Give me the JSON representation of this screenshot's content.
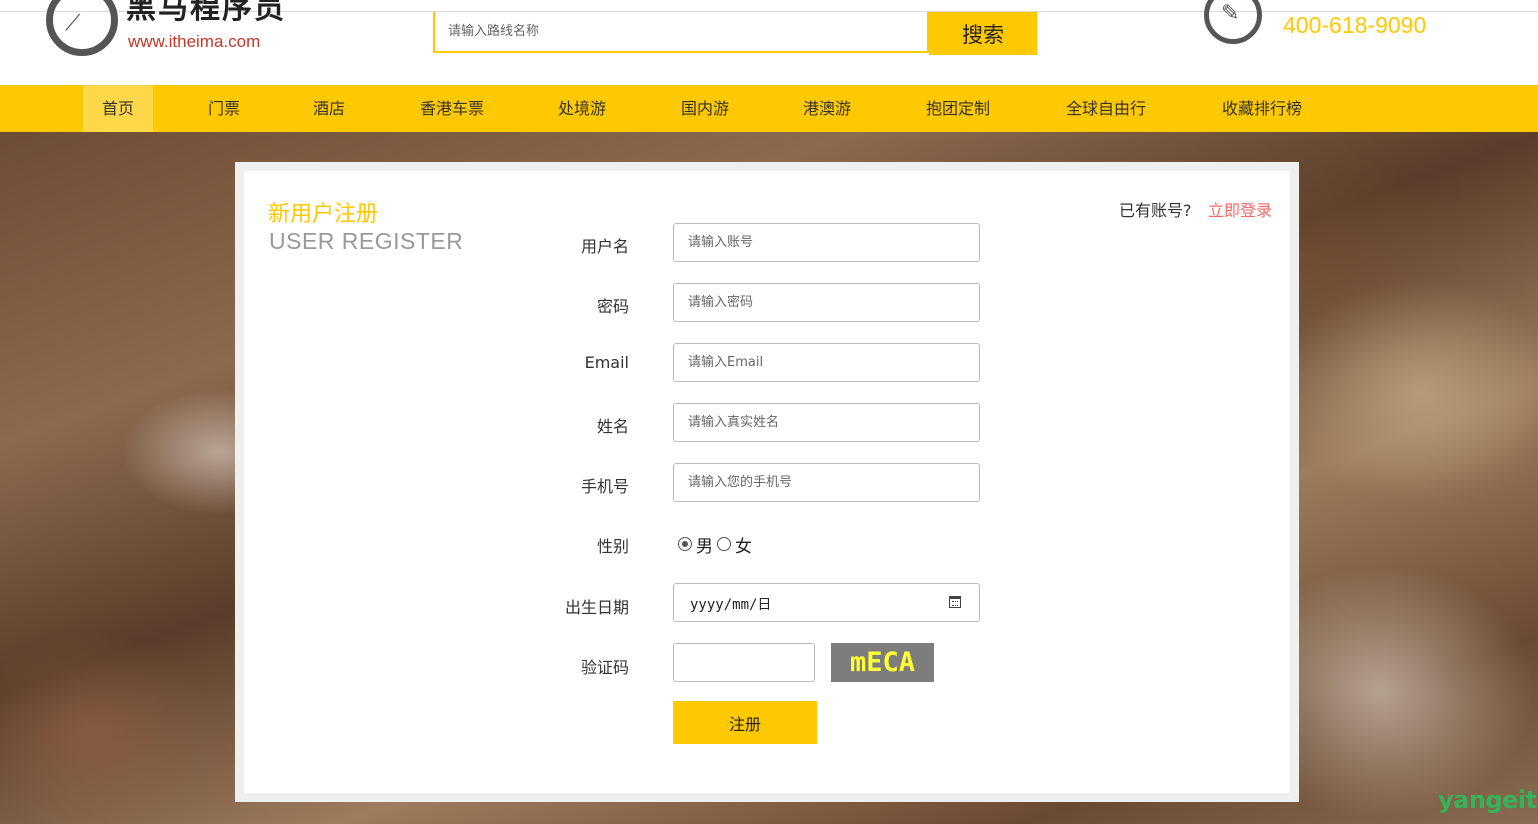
{
  "header": {
    "logo_cn": "黑马程序员",
    "logo_url": "www.itheima.com",
    "search_placeholder": "请输入路线名称",
    "search_button": "搜索",
    "phone": "400-618-9090"
  },
  "nav": {
    "items": [
      "首页",
      "门票",
      "酒店",
      "香港车票",
      "处境游",
      "国内游",
      "港澳游",
      "抱团定制",
      "全球自由行",
      "收藏排行榜"
    ],
    "active_index": 0
  },
  "form": {
    "title_cn": "新用户注册",
    "title_en": "USER REGISTER",
    "has_account": "已有账号?",
    "login_link": "立即登录",
    "fields": {
      "username": {
        "label": "用户名",
        "placeholder": "请输入账号"
      },
      "password": {
        "label": "密码",
        "placeholder": "请输入密码"
      },
      "email": {
        "label": "Email",
        "placeholder": "请输入Email"
      },
      "name": {
        "label": "姓名",
        "placeholder": "请输入真实姓名"
      },
      "phone": {
        "label": "手机号",
        "placeholder": "请输入您的手机号"
      },
      "gender": {
        "label": "性别",
        "male": "男",
        "female": "女",
        "selected": "男"
      },
      "birthday": {
        "label": "出生日期",
        "placeholder": "yyyy/mm/日"
      },
      "captcha": {
        "label": "验证码",
        "image_text": "mECA"
      }
    },
    "submit": "注册"
  },
  "watermark": "yangeit"
}
